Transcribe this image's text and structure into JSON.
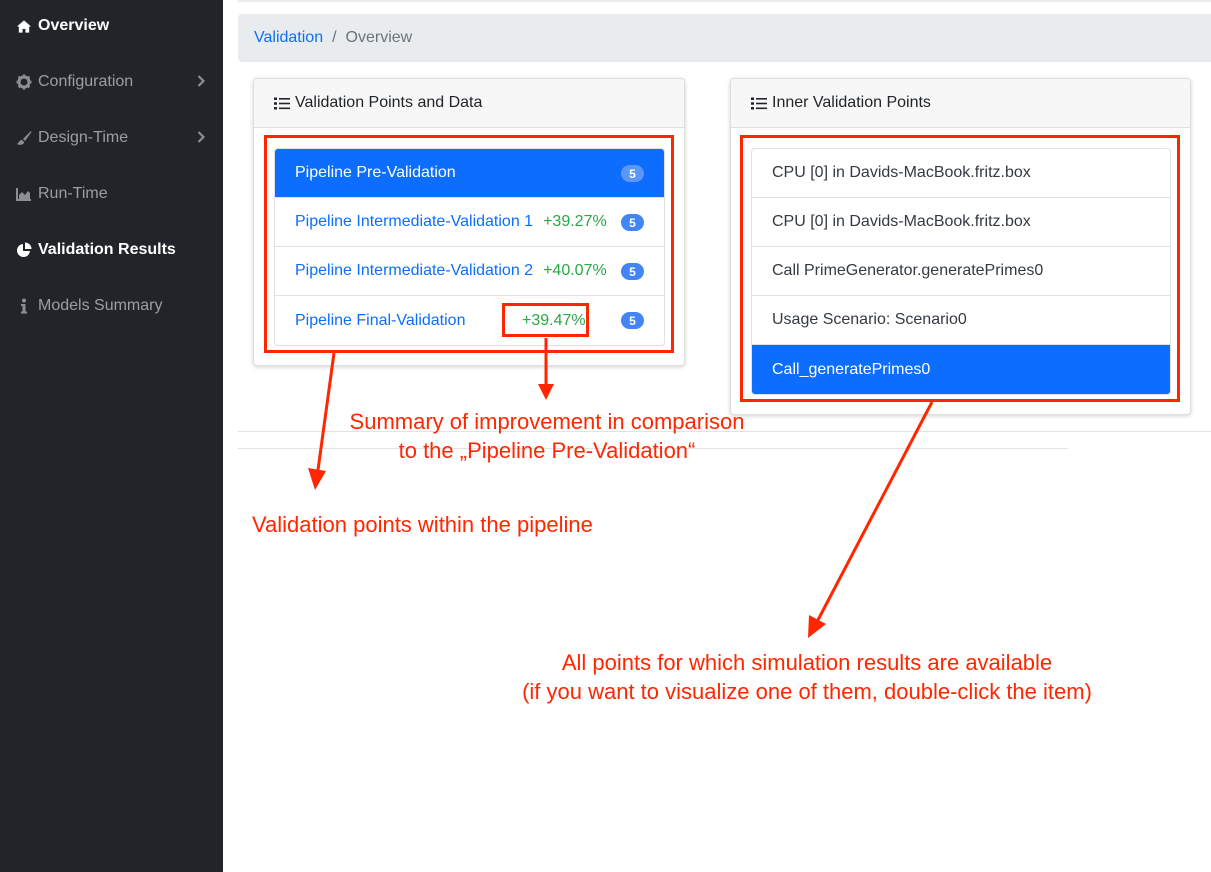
{
  "sidebar": {
    "items": [
      {
        "label": "Overview",
        "icon": "home-icon"
      },
      {
        "label": "Configuration",
        "icon": "gear-icon"
      },
      {
        "label": "Design-Time",
        "icon": "brush-icon"
      },
      {
        "label": "Run-Time",
        "icon": "area-chart-icon"
      },
      {
        "label": "Validation Results",
        "icon": "pie-chart-icon"
      },
      {
        "label": "Models Summary",
        "icon": "info-icon"
      }
    ]
  },
  "breadcrumb": {
    "link": "Validation",
    "separator": "/",
    "current": "Overview"
  },
  "left_card": {
    "title": "Validation Points and Data",
    "items": [
      {
        "label": "Pipeline Pre-Validation",
        "improvement": "",
        "count": "5"
      },
      {
        "label": "Pipeline Intermediate-Validation 1",
        "improvement": "+39.27%",
        "count": "5"
      },
      {
        "label": "Pipeline Intermediate-Validation 2",
        "improvement": "+40.07%",
        "count": "5"
      },
      {
        "label": "Pipeline Final-Validation",
        "improvement": "+39.47%",
        "count": "5"
      }
    ]
  },
  "right_card": {
    "title": "Inner Validation Points",
    "items": [
      "CPU [0] in Davids-MacBook.fritz.box",
      "CPU [0] in Davids-MacBook.fritz.box",
      "Call PrimeGenerator.generatePrimes0",
      "Usage Scenario: Scenario0",
      "Call_generatePrimes0"
    ]
  },
  "annotations": {
    "improvement_summary": [
      "Summary of improvement in comparison",
      "to the „Pipeline Pre-Validation“"
    ],
    "validation_points": "Validation points within the pipeline",
    "simulation_points": [
      "All points for which simulation results are available",
      "(if you want to visualize one of them, double-click the item)"
    ]
  },
  "colors": {
    "sidebar_bg": "#212529",
    "accent": "#0d6efd",
    "improvement": "#28a745",
    "annotation": "#ff2600"
  }
}
